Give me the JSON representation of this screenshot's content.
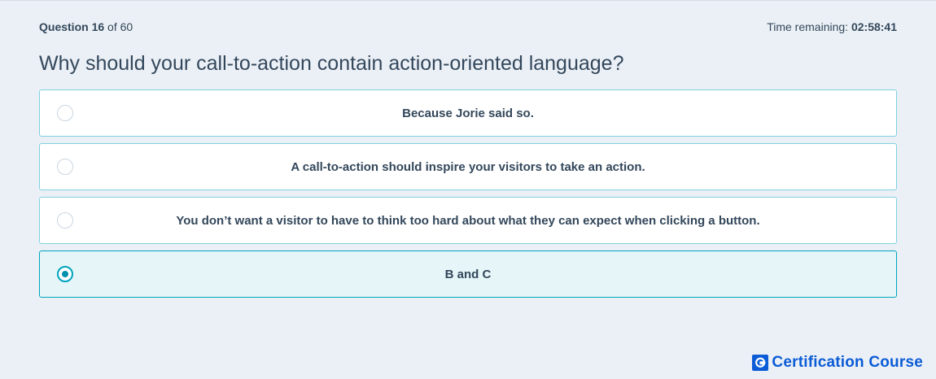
{
  "header": {
    "question_prefix": "Question",
    "question_number": "16",
    "question_of": "of 60",
    "time_label": "Time remaining:",
    "time_value": "02:58:41"
  },
  "question": {
    "text": "Why should your call-to-action contain action-oriented language?"
  },
  "options": [
    {
      "label": "Because Jorie said so.",
      "selected": false
    },
    {
      "label": "A call-to-action should inspire your visitors to take an action.",
      "selected": false
    },
    {
      "label": "You don’t want a visitor to have to think too hard about what they can expect when clicking a button.",
      "selected": false
    },
    {
      "label": "B and C",
      "selected": true
    }
  ],
  "brand": {
    "mark": "G",
    "name": "Certification Course",
    "color": "#0b5cd6"
  },
  "colors": {
    "accent": "#00a4bd",
    "radio_dot": "#0091ae",
    "text": "#33475b",
    "background": "#ebf0f6"
  }
}
